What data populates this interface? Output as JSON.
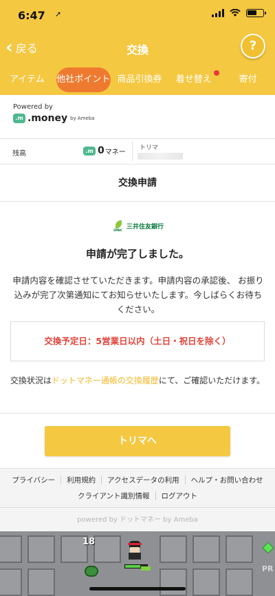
{
  "status_bar": {
    "time": "6:47",
    "location_icon": "location-arrow-icon"
  },
  "header": {
    "back_label": "戻る",
    "title": "交換",
    "help_label": "?"
  },
  "tabs": [
    {
      "label": "アイテム",
      "active": false
    },
    {
      "label": "他社ポイント",
      "active": true
    },
    {
      "label": "商品引換券",
      "active": false
    },
    {
      "label": "着せ替え",
      "active": false,
      "notification": true
    },
    {
      "label": "寄付",
      "active": false
    }
  ],
  "powered": {
    "text": "Powered by",
    "logo_badge": ".m",
    "logo_word": ".money",
    "logo_by": "by Ameba"
  },
  "balance": {
    "label": "残高",
    "badge": ".m",
    "amount": "0",
    "unit": "マネー",
    "trima_label": "トリマ"
  },
  "section_title": "交換申請",
  "bank": {
    "mark": "SMBC",
    "name": "三井住友銀行"
  },
  "completion": {
    "title": "申請が完了しました。",
    "description": "申請内容を確認させていただきます。申請内容の承認後、 お振り込みが完了次第通知にてお知らせいたします。今しばらくお待ちください。"
  },
  "schedule": "交換予定日：5営業日以内（土日・祝日を除く）",
  "status_note": {
    "prefix": "交換状況は",
    "link": "ドットマネー通帳の交換履歴",
    "suffix": "にて、ご確認いただけます。"
  },
  "cta_label": "トリマへ",
  "footer": {
    "links_row1": [
      "プライバシー",
      "利用規約",
      "アクセスデータの利用",
      "ヘルプ・お問い合わせ"
    ],
    "links_row2": [
      "クライアント識別情報",
      "ログアウト"
    ],
    "powered": "powered by ドットマネー by Ameba"
  },
  "game": {
    "counter": "18",
    "corner_text": "PR"
  },
  "colors": {
    "brand_yellow": "#f5c842",
    "active_tab": "#ee7a2f",
    "alert_red": "#e0443a",
    "link_yellow": "#f2b728",
    "money_green": "#4fb88f"
  }
}
